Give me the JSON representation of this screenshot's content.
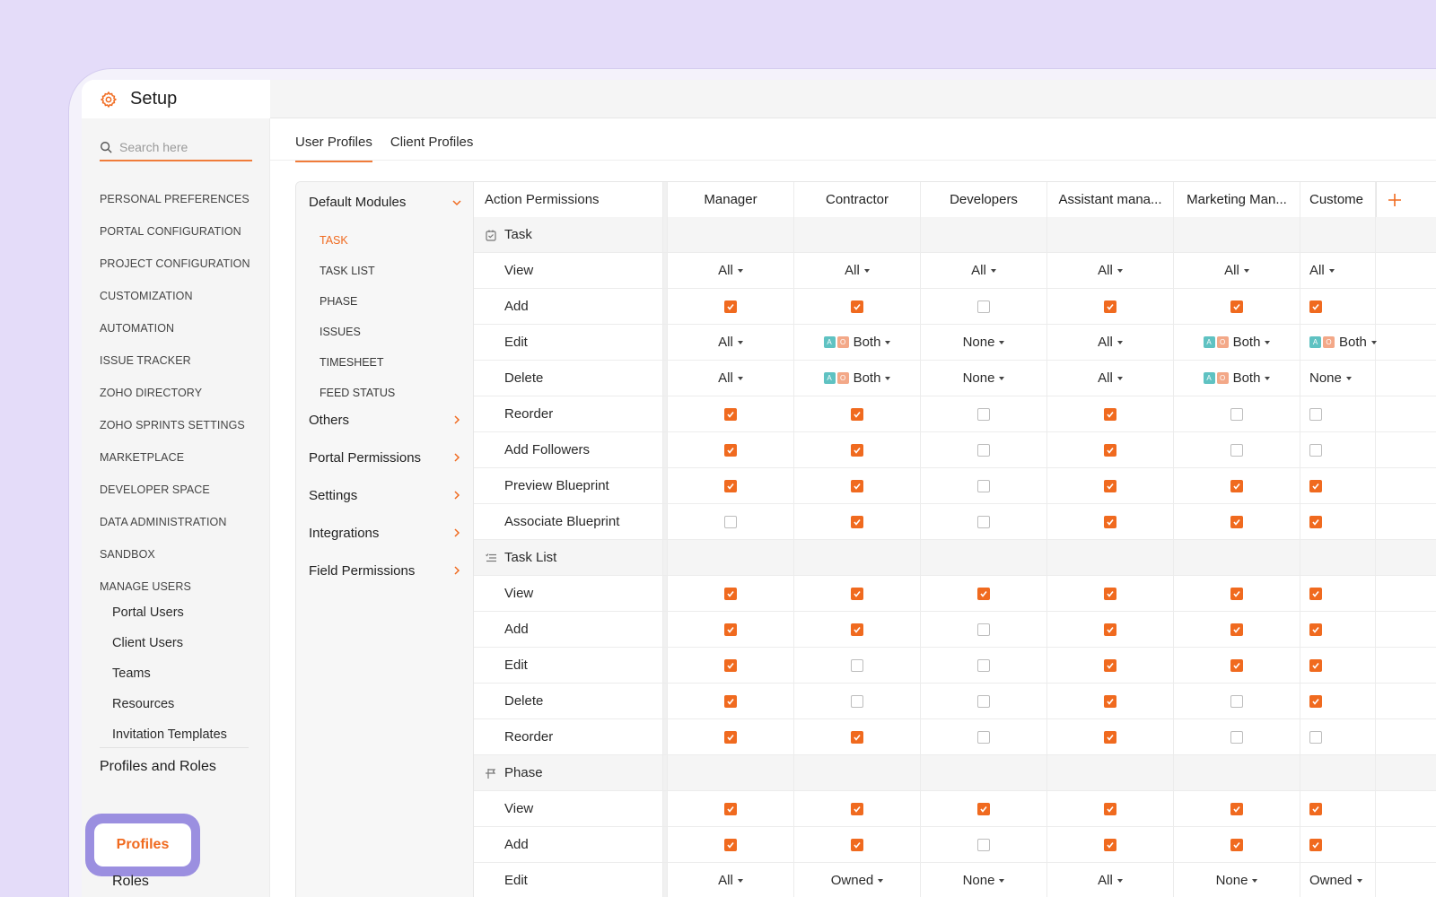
{
  "header": {
    "title": "Setup",
    "icon": "gear-icon",
    "accent": "#f06a1f"
  },
  "search": {
    "placeholder": "Search here"
  },
  "sidebar": {
    "items": [
      "PERSONAL PREFERENCES",
      "PORTAL CONFIGURATION",
      "PROJECT CONFIGURATION",
      "CUSTOMIZATION",
      "AUTOMATION",
      "ISSUE TRACKER",
      "ZOHO DIRECTORY",
      "ZOHO SPRINTS SETTINGS",
      "MARKETPLACE",
      "DEVELOPER SPACE",
      "DATA ADMINISTRATION",
      "SANDBOX",
      "MANAGE USERS"
    ],
    "manage_users": [
      "Portal Users",
      "Client Users",
      "Teams",
      "Resources",
      "Invitation Templates"
    ],
    "profiles_and_roles": "Profiles and Roles",
    "profiles": "Profiles",
    "roles": "Roles"
  },
  "tabs": [
    "User Profiles",
    "Client Profiles"
  ],
  "modules": {
    "title": "Default Modules",
    "items": [
      "TASK",
      "TASK LIST",
      "PHASE",
      "ISSUES",
      "TIMESHEET",
      "FEED STATUS"
    ],
    "groups": [
      "Others",
      "Portal Permissions",
      "Settings",
      "Integrations",
      "Field Permissions"
    ]
  },
  "table": {
    "action_header": "Action Permissions",
    "columns": [
      "Manager",
      "Contractor",
      "Developers",
      "Assistant mana...",
      "Marketing Man...",
      "Custome"
    ],
    "rows": [
      {
        "type": "section",
        "label": "Task",
        "icon": "task-icon"
      },
      {
        "label": "View",
        "cells": [
          "All",
          "All",
          "All",
          "All",
          "All",
          "All"
        ]
      },
      {
        "label": "Add",
        "cells": [
          true,
          true,
          false,
          true,
          true,
          true
        ]
      },
      {
        "label": "Edit",
        "cells": [
          "All",
          "Both*",
          "None",
          "All",
          "Both*",
          "Both*"
        ]
      },
      {
        "label": "Delete",
        "cells": [
          "All",
          "Both*",
          "None",
          "All",
          "Both*",
          "None"
        ]
      },
      {
        "label": "Reorder",
        "cells": [
          true,
          true,
          false,
          true,
          false,
          false
        ]
      },
      {
        "label": "Add Followers",
        "cells": [
          true,
          true,
          false,
          true,
          false,
          false
        ]
      },
      {
        "label": "Preview Blueprint",
        "cells": [
          true,
          true,
          false,
          true,
          true,
          true
        ]
      },
      {
        "label": "Associate Blueprint",
        "cells": [
          false,
          true,
          false,
          true,
          true,
          true
        ]
      },
      {
        "type": "section",
        "label": "Task List",
        "icon": "task-list-icon"
      },
      {
        "label": "View",
        "cells": [
          true,
          true,
          true,
          true,
          true,
          true
        ]
      },
      {
        "label": "Add",
        "cells": [
          true,
          true,
          false,
          true,
          true,
          true
        ]
      },
      {
        "label": "Edit",
        "cells": [
          true,
          false,
          false,
          true,
          true,
          true
        ]
      },
      {
        "label": "Delete",
        "cells": [
          true,
          false,
          false,
          true,
          false,
          true
        ]
      },
      {
        "label": "Reorder",
        "cells": [
          true,
          true,
          false,
          true,
          false,
          false
        ]
      },
      {
        "type": "section",
        "label": "Phase",
        "icon": "phase-icon"
      },
      {
        "label": "View",
        "cells": [
          true,
          true,
          true,
          true,
          true,
          true
        ]
      },
      {
        "label": "Add",
        "cells": [
          true,
          true,
          false,
          true,
          true,
          true
        ]
      },
      {
        "label": "Edit",
        "cells": [
          "All",
          "Owned",
          "None",
          "All",
          "None",
          "Owned"
        ]
      }
    ]
  }
}
